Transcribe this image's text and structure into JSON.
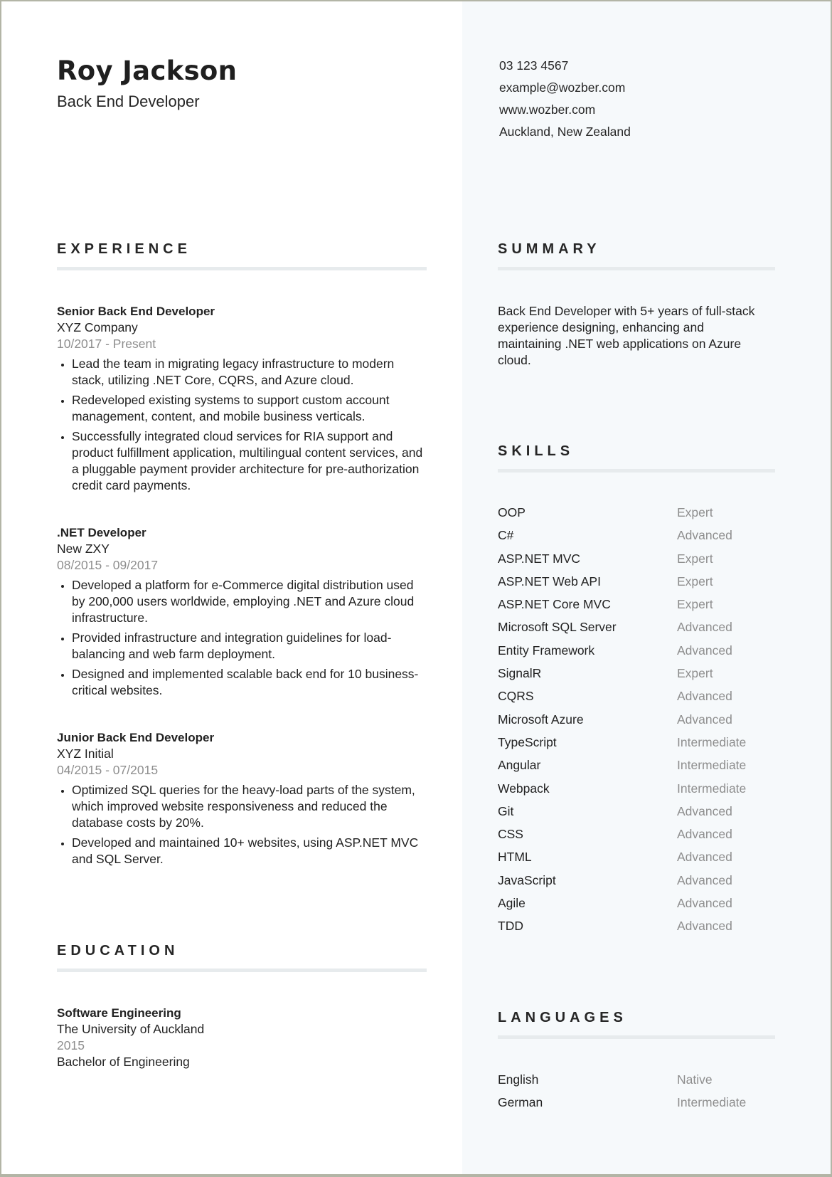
{
  "header": {
    "name": "Roy Jackson",
    "title": "Back End Developer"
  },
  "contact": {
    "phone": "03 123 4567",
    "email": "example@wozber.com",
    "website": "www.wozber.com",
    "location": "Auckland, New Zealand"
  },
  "experience": {
    "heading": "EXPERIENCE",
    "entries": [
      {
        "title": "Senior Back End Developer",
        "company": "XYZ Company",
        "dates": "10/2017 - Present",
        "bullets": [
          "Lead the team in migrating legacy infrastructure to modern stack, utilizing .NET Core, CQRS, and Azure cloud.",
          "Redeveloped existing systems to support custom account management, content, and mobile business verticals.",
          "Successfully integrated cloud services for RIA support and product fulfillment application, multilingual content services, and a pluggable payment provider architecture for pre-authorization credit card payments."
        ]
      },
      {
        "title": ".NET Developer",
        "company": "New ZXY",
        "dates": "08/2015 - 09/2017",
        "bullets": [
          "Developed a platform for e-Commerce digital distribution used by 200,000 users worldwide, employing .NET and Azure cloud infrastructure.",
          "Provided infrastructure and integration guidelines for load-balancing and web farm deployment.",
          "Designed and implemented scalable back end for 10 business-critical websites."
        ]
      },
      {
        "title": "Junior Back End Developer",
        "company": "XYZ Initial",
        "dates": "04/2015 - 07/2015",
        "bullets": [
          "Optimized SQL queries for the heavy-load parts of the system, which improved website responsiveness and reduced the database costs by 20%.",
          "Developed and maintained 10+ websites, using ASP.NET MVC and SQL Server."
        ]
      }
    ]
  },
  "education": {
    "heading": "EDUCATION",
    "entries": [
      {
        "field": "Software Engineering",
        "school": "The University of Auckland",
        "year": "2015",
        "degree": "Bachelor of Engineering"
      }
    ]
  },
  "summary": {
    "heading": "SUMMARY",
    "text": "Back End Developer with 5+ years of full-stack experience designing, enhancing and maintaining .NET web applications on Azure cloud."
  },
  "skills": {
    "heading": "SKILLS",
    "items": [
      {
        "name": "OOP",
        "level": "Expert"
      },
      {
        "name": "C#",
        "level": "Advanced"
      },
      {
        "name": "ASP.NET MVC",
        "level": "Expert"
      },
      {
        "name": "ASP.NET Web API",
        "level": "Expert"
      },
      {
        "name": "ASP.NET Core MVC",
        "level": "Expert"
      },
      {
        "name": "Microsoft SQL Server",
        "level": "Advanced"
      },
      {
        "name": "Entity Framework",
        "level": "Advanced"
      },
      {
        "name": "SignalR",
        "level": "Expert"
      },
      {
        "name": "CQRS",
        "level": "Advanced"
      },
      {
        "name": "Microsoft Azure",
        "level": "Advanced"
      },
      {
        "name": "TypeScript",
        "level": "Intermediate"
      },
      {
        "name": "Angular",
        "level": "Intermediate"
      },
      {
        "name": "Webpack",
        "level": "Intermediate"
      },
      {
        "name": "Git",
        "level": "Advanced"
      },
      {
        "name": "CSS",
        "level": "Advanced"
      },
      {
        "name": "HTML",
        "level": "Advanced"
      },
      {
        "name": "JavaScript",
        "level": "Advanced"
      },
      {
        "name": "Agile",
        "level": "Advanced"
      },
      {
        "name": "TDD",
        "level": "Advanced"
      }
    ]
  },
  "languages": {
    "heading": "LANGUAGES",
    "items": [
      {
        "name": "English",
        "level": "Native"
      },
      {
        "name": "German",
        "level": "Intermediate"
      }
    ]
  },
  "colors": {
    "sidebar_bg": "#f6f9fb",
    "rule": "#e7ebed",
    "muted_text": "#8e8e8e",
    "text": "#222222"
  }
}
